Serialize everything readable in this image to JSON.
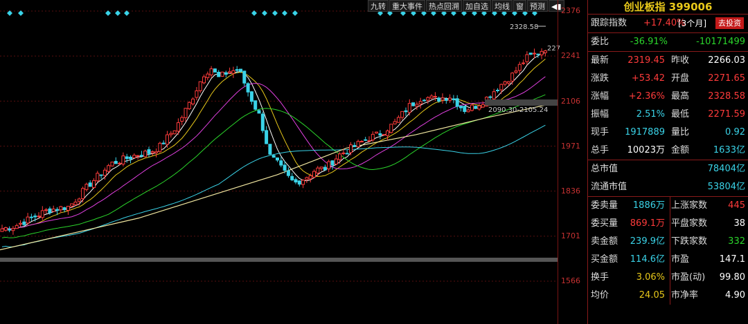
{
  "toolbar": {
    "items": [
      "九转",
      "重大事件",
      "热点回溯",
      "加自选",
      "均线",
      "窗",
      "预测"
    ],
    "arrow": "◀▮"
  },
  "axis": {
    "ticks": [
      "2376",
      "2241",
      "2106",
      "1971",
      "1836",
      "1701",
      "1566"
    ]
  },
  "chart_labels": {
    "high_value": "2328.58",
    "right_clip": "227",
    "range_label": "2090.30-2105.24"
  },
  "panel": {
    "title": "创业板指 399006",
    "track": {
      "label": "跟踪指数",
      "value": "+17.40%",
      "period": "[3个月]",
      "button": "去投资"
    },
    "weibi": {
      "label": "委比",
      "pct": "-36.91%",
      "diff": "-10171499"
    },
    "rows": [
      {
        "l1": "最新",
        "v1": "2319.45",
        "c1": "red",
        "l2": "昨收",
        "v2": "2266.03",
        "c2": "white"
      },
      {
        "l1": "涨跌",
        "v1": "+53.42",
        "c1": "red",
        "l2": "开盘",
        "v2": "2271.65",
        "c2": "red"
      },
      {
        "l1": "涨幅",
        "v1": "+2.36%",
        "c1": "red",
        "l2": "最高",
        "v2": "2328.58",
        "c2": "red"
      },
      {
        "l1": "振幅",
        "v1": "2.51%",
        "c1": "cyan",
        "l2": "最低",
        "v2": "2271.59",
        "c2": "red"
      },
      {
        "l1": "现手",
        "v1": "1917889",
        "c1": "cyan",
        "l2": "量比",
        "v2": "0.92",
        "c2": "cyan"
      },
      {
        "l1": "总手",
        "v1": "10023万",
        "c1": "white",
        "l2": "金额",
        "v2": "1633亿",
        "c2": "cyan"
      }
    ],
    "market": [
      {
        "label": "总市值",
        "value": "78404亿"
      },
      {
        "label": "流通市值",
        "value": "53804亿"
      }
    ],
    "bottom": [
      {
        "l1": "委卖量",
        "v1": "1886万",
        "c1": "cyan",
        "l2": "上涨家数",
        "v2": "445",
        "c2": "red"
      },
      {
        "l1": "委买量",
        "v1": "869.1万",
        "c1": "red",
        "l2": "平盘家数",
        "v2": "38",
        "c2": "white"
      },
      {
        "l1": "卖金额",
        "v1": "239.9亿",
        "c1": "cyan",
        "l2": "下跌家数",
        "v2": "332",
        "c2": "green"
      },
      {
        "l1": "买金额",
        "v1": "114.6亿",
        "c1": "cyan",
        "l2": "市盈",
        "v2": "147.1",
        "c2": "white"
      },
      {
        "l1": "换手",
        "v1": "3.06%",
        "c1": "yellow",
        "l2": "市盈(动)",
        "v2": "99.80",
        "c2": "white"
      },
      {
        "l1": "均价",
        "v1": "24.05",
        "c1": "yellow",
        "l2": "市净率",
        "v2": "4.90",
        "c2": "white"
      }
    ]
  },
  "colors": {
    "up": "#ff3b3b",
    "down": "#3ad3e8",
    "ma5": "#ffffff",
    "ma10": "#e8c81a",
    "ma20": "#e040e0",
    "ma30": "#2bd62b",
    "ma60": "#3ad3e8",
    "ma120": "#f0e6a0"
  }
}
